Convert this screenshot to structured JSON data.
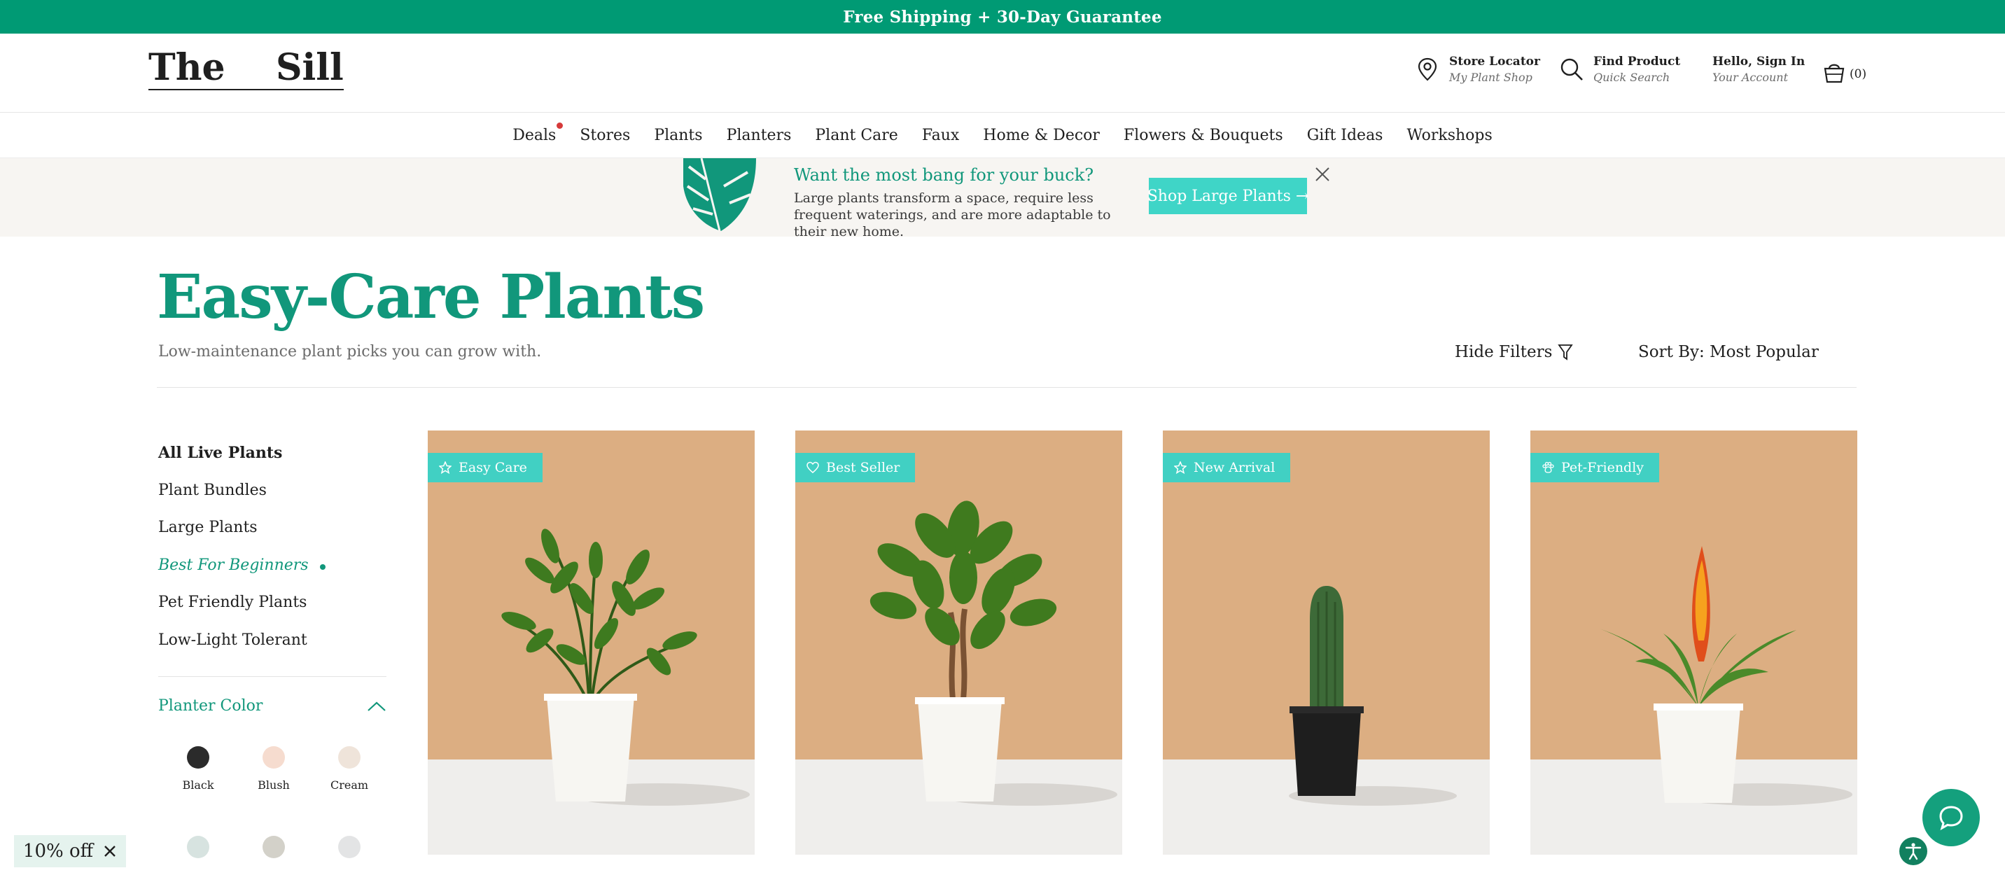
{
  "announcement": "Free Shipping + 30-Day Guarantee",
  "logo": "The    Sill",
  "header": {
    "store_locator": {
      "title": "Store Locator",
      "subtitle": "My Plant Shop"
    },
    "find_product": {
      "title": "Find Product",
      "subtitle": "Quick Search"
    },
    "account": {
      "title": "Hello, Sign In",
      "subtitle": "Your Account"
    },
    "cart_count": "(0)"
  },
  "nav": [
    "Deals",
    "Stores",
    "Plants",
    "Planters",
    "Plant Care",
    "Faux",
    "Home & Decor",
    "Flowers & Bouquets",
    "Gift Ideas",
    "Workshops"
  ],
  "promo": {
    "title": "Want the most bang for your buck?",
    "description": "Large plants transform a space, require less frequent waterings, and are more adaptable to their new home.",
    "button": "Shop Large Plants →"
  },
  "page": {
    "title": "Easy-Care Plants",
    "subtitle": "Low-maintenance plant picks you can grow with.",
    "hide_filters": "Hide Filters",
    "sort_by": "Sort By: Most Popular"
  },
  "sidebar": {
    "categories": [
      "All Live Plants",
      "Plant Bundles",
      "Large Plants",
      "Best For Beginners",
      "Pet Friendly Plants",
      "Low-Light Tolerant"
    ],
    "active_index": 3,
    "filter_title": "Planter Color",
    "colors": [
      {
        "name": "Black",
        "hex": "#2b2b2b"
      },
      {
        "name": "Blush",
        "hex": "#f6dccf"
      },
      {
        "name": "Cream",
        "hex": "#efe4da"
      },
      {
        "name": "",
        "hex": "#d7e3e0"
      },
      {
        "name": "",
        "hex": "#d3d1c9"
      },
      {
        "name": "",
        "hex": "#e3e4e5"
      }
    ]
  },
  "products": [
    {
      "badge": "Easy Care",
      "badge_icon": "star-icon"
    },
    {
      "badge": "Best Seller",
      "badge_icon": "heart-icon"
    },
    {
      "badge": "New Arrival",
      "badge_icon": "star-icon"
    },
    {
      "badge": "Pet-Friendly",
      "badge_icon": "paw-icon"
    }
  ],
  "discount": "10% off",
  "colors": {
    "brand": "#009a74",
    "accent": "#41d0c3",
    "title": "#11977b"
  }
}
